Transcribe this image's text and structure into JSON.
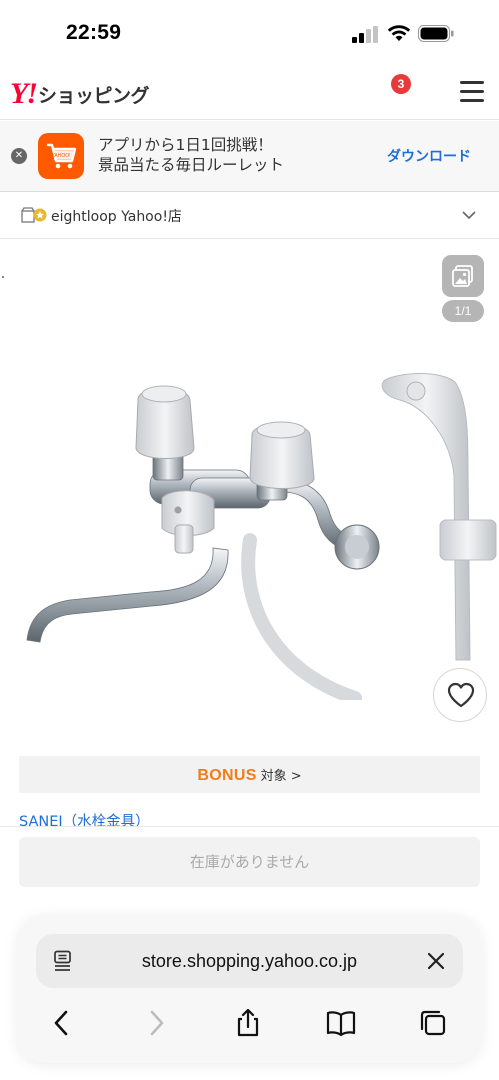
{
  "status_bar": {
    "time": "22:59"
  },
  "header": {
    "logo_mark": "Y!",
    "logo_text": "ショッピング",
    "cart_count": "3"
  },
  "app_banner": {
    "line1": "アプリから1日1回挑戦！",
    "line2": "景品当たる毎日ルーレット",
    "download_label": "ダウンロード",
    "app_icon_text": "YAHOO!"
  },
  "store": {
    "name": "eightloop Yahoo!店"
  },
  "gallery": {
    "counter": "1/1"
  },
  "bonus": {
    "bonus_label": "BONUS",
    "target_label": "対象",
    "chevron": ">"
  },
  "product": {
    "brand_link": "SANEI（水栓金具）"
  },
  "purchase": {
    "out_of_stock_label": "在庫がありません"
  },
  "browser": {
    "url": "store.shopping.yahoo.co.jp"
  },
  "colors": {
    "accent_red": "#ff0033",
    "link_blue": "#1e6ed6",
    "bonus_orange": "#f07d1a",
    "badge_red": "#e83a3a"
  }
}
